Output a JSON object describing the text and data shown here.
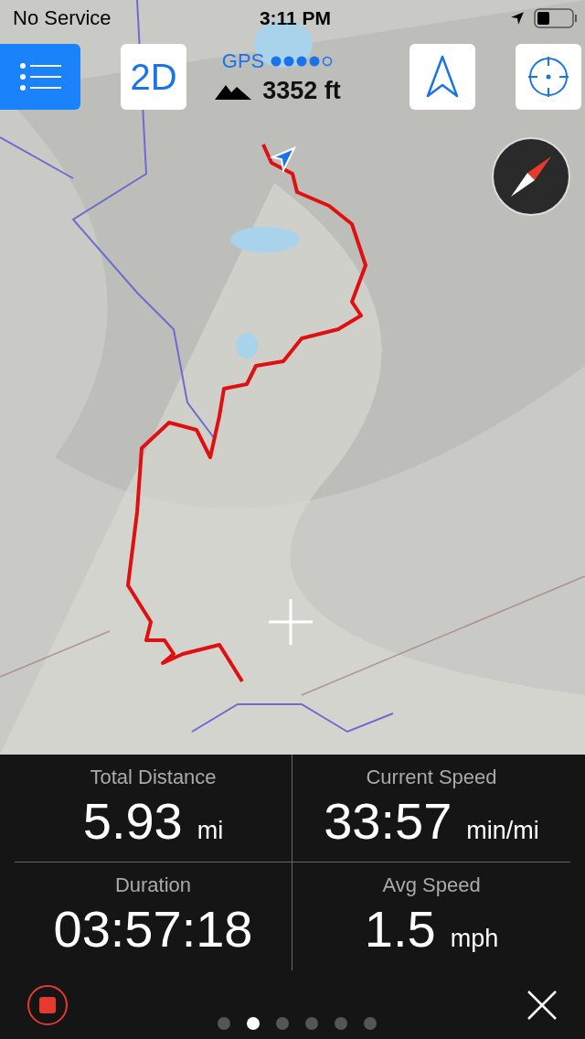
{
  "status_bar": {
    "carrier": "No Service",
    "time": "3:11 PM"
  },
  "toolbar": {
    "mode_button": "2D",
    "gps_label": "GPS",
    "elevation": "3352 ft"
  },
  "stats": [
    {
      "label": "Total Distance",
      "value": "5.93",
      "unit": "mi"
    },
    {
      "label": "Current Speed",
      "value": "33:57",
      "unit": "min/mi"
    },
    {
      "label": "Duration",
      "value": "03:57:18"
    },
    {
      "label": "Avg Speed",
      "value": "1.5",
      "unit": "mph"
    }
  ],
  "page_dots": [
    {
      "selected": false
    },
    {
      "selected": true
    },
    {
      "selected": false
    },
    {
      "selected": false
    },
    {
      "selected": false
    },
    {
      "selected": false
    }
  ]
}
